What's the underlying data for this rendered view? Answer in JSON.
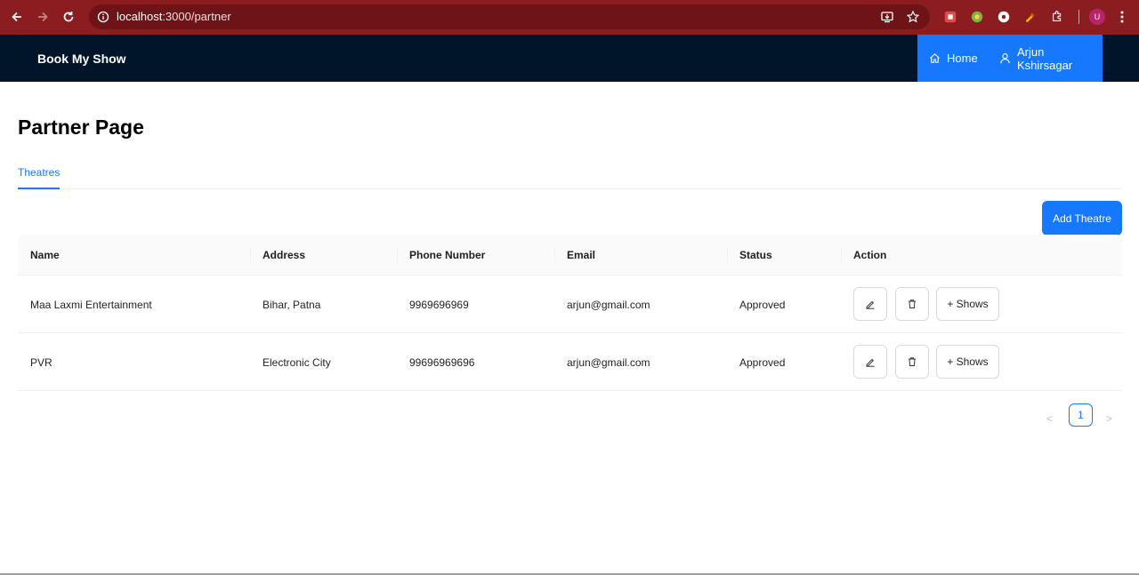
{
  "browser": {
    "url_host": "localhost",
    "url_path": ":3000/partner",
    "profile_initial": "U",
    "accent": "#8b1d20"
  },
  "header": {
    "brand": "Book My Show",
    "menu": [
      {
        "label": "Home",
        "icon": "home-icon"
      },
      {
        "label": "Arjun Kshirsagar",
        "icon": "user-icon"
      }
    ],
    "menu_color": "#1677ff",
    "bg_color": "#001529"
  },
  "page": {
    "title": "Partner Page",
    "tabs": [
      {
        "label": "Theatres",
        "active": true
      }
    ],
    "add_button": "Add Theatre"
  },
  "table": {
    "columns": [
      "Name",
      "Address",
      "Phone Number",
      "Email",
      "Status",
      "Action"
    ],
    "rows": [
      {
        "name": "Maa Laxmi Entertainment",
        "address": "Bihar, Patna",
        "phone": "9969696969",
        "email": "arjun@gmail.com",
        "status": "Approved"
      },
      {
        "name": "PVR",
        "address": "Electronic City",
        "phone": "99696969696",
        "email": "arjun@gmail.com",
        "status": "Approved"
      }
    ],
    "action_shows_label": "+ Shows"
  },
  "pagination": {
    "current_page": "1",
    "prev": "<",
    "next": ">"
  }
}
